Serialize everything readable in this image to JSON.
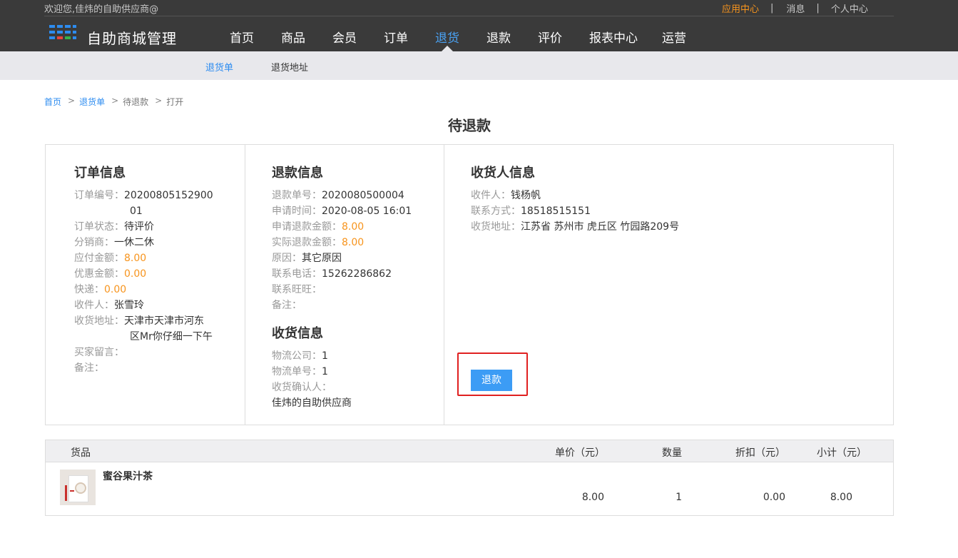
{
  "topbar": {
    "welcome": "欢迎您,佳炜的自助供应商@",
    "app_center": "应用中心",
    "messages": "消息",
    "personal_center": "个人中心",
    "separator": "|"
  },
  "brand": {
    "title": "自助商城管理",
    "logo_icon": "grid-logo-icon"
  },
  "main_nav": [
    {
      "label": "首页",
      "active": false
    },
    {
      "label": "商品",
      "active": false
    },
    {
      "label": "会员",
      "active": false
    },
    {
      "label": "订单",
      "active": false
    },
    {
      "label": "退货",
      "active": true
    },
    {
      "label": "退款",
      "active": false
    },
    {
      "label": "评价",
      "active": false
    },
    {
      "label": "报表中心",
      "active": false
    },
    {
      "label": "运营",
      "active": false
    }
  ],
  "sub_nav": [
    {
      "label": "退货单",
      "active": true
    },
    {
      "label": "退货地址",
      "active": false
    }
  ],
  "breadcrumb": {
    "home": "首页",
    "return_orders": "退货单",
    "pending_refund": "待退款",
    "open": "打开",
    "separator": ">"
  },
  "page_title": "待退款",
  "order_info": {
    "title": "订单信息",
    "order_no_label": "订单编号：",
    "order_no_line1": "2020080515290​0",
    "order_no_line2": "01",
    "status_label": "订单状态：",
    "status": "待评价",
    "distributor_label": "分销商：",
    "distributor": "一休二休",
    "payable_label": "应付金额：",
    "payable": "8.00",
    "discount_label": "优惠金额：",
    "discount": "0.00",
    "shipping_label": "快递：",
    "shipping": "0.00",
    "receiver_label": "收件人：",
    "receiver": "张雪玲",
    "address_label": "收货地址：",
    "address_line1": "天津市天津市河东",
    "address_line2": "区Mr你仔细一下午",
    "buyer_message_label": "买家留言：",
    "remark_label": "备注："
  },
  "refund_info": {
    "title": "退款信息",
    "refund_no_label": "退款单号：",
    "refund_no": "2020080500004",
    "apply_time_label": "申请时间：",
    "apply_time": "2020-08-05 16:01",
    "apply_amount_label": "申请退款金额：",
    "apply_amount": "8.00",
    "actual_amount_label": "实际退款金额：",
    "actual_amount": "8.00",
    "reason_label": "原因：",
    "reason": "其它原因",
    "phone_label": "联系电话：",
    "phone": "15262286862",
    "wangwang_label": "联系旺旺：",
    "remark_label": "备注："
  },
  "receive_info": {
    "title": "收货信息",
    "logistics_company_label": "物流公司：",
    "logistics_company": "1",
    "tracking_no_label": "物流单号：",
    "tracking_no": "1",
    "confirmer_label": "收货确认人：",
    "confirmer": "佳炜的自助供应商"
  },
  "consignee_info": {
    "title": "收货人信息",
    "name_label": "收件人：",
    "name": "钱杨帆",
    "contact_label": "联系方式：",
    "contact": "18518515151",
    "address_label": "收货地址：",
    "address": "江苏省 苏州市 虎丘区 竹园路209号"
  },
  "refund_button": "退款",
  "goods_table": {
    "headers": {
      "goods": "货品",
      "unit_price": "单价（元）",
      "quantity": "数量",
      "discount": "折扣（元）",
      "subtotal": "小计（元）"
    },
    "rows": [
      {
        "name": "蜜谷果汁茶",
        "unit_price": "8.00",
        "quantity": "1",
        "discount": "0.00",
        "subtotal": "8.00"
      }
    ]
  },
  "colors": {
    "accent": "#2d8cf0",
    "orange": "#f7941d",
    "topbar": "#3a3a3a",
    "highlight": "#e02020"
  }
}
